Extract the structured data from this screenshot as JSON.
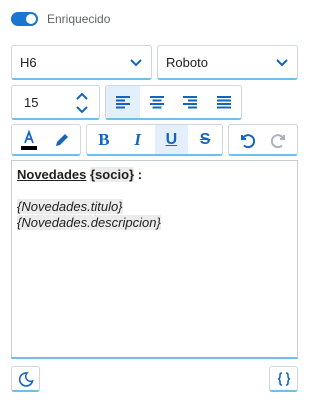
{
  "toggle": {
    "label": "Enriquecido",
    "on": true,
    "color": "#1976d2"
  },
  "heading_select": {
    "value": "H6"
  },
  "font_select": {
    "value": "Roboto"
  },
  "font_size": {
    "value": "15"
  },
  "alignment": {
    "active": "left",
    "buttons": [
      "align-left-icon",
      "align-center-icon",
      "align-right-icon",
      "align-justify-icon"
    ]
  },
  "style_buttons": {
    "bold": "B",
    "italic": "I",
    "underline": "U",
    "strike": "S",
    "active": "underline"
  },
  "editor": {
    "line1_word": "Novedades",
    "line1_token": "{socio}",
    "line1_tail": " :",
    "line2": "{Novedades.titulo}",
    "line3": "{Novedades.descripcion}"
  },
  "colors": {
    "accent": "#1976d2",
    "underline_accent": "#6ec0ea",
    "icon_blue": "#1565c0"
  }
}
